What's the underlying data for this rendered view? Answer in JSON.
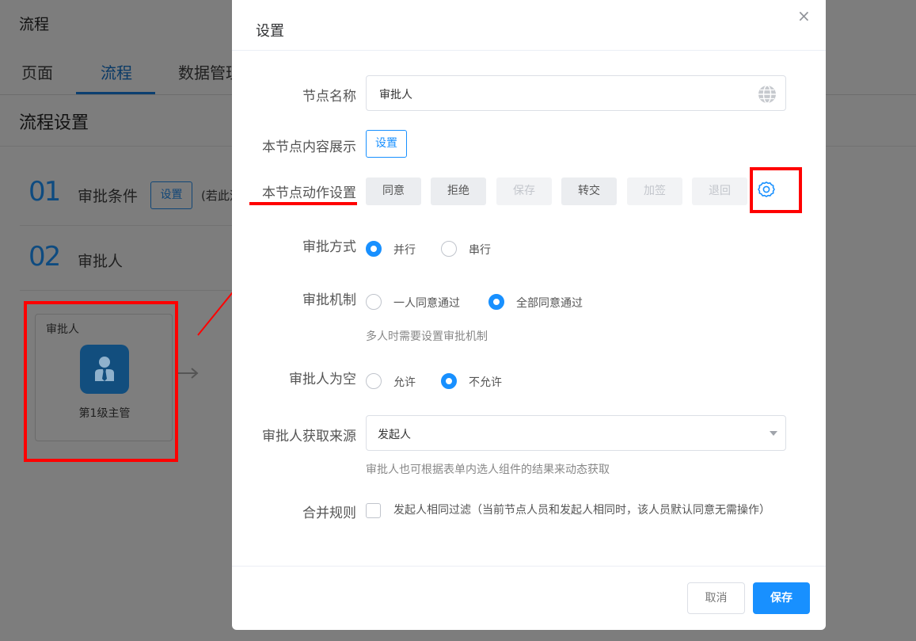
{
  "background": {
    "page_title": "流程",
    "tabs": [
      {
        "label": "页面"
      },
      {
        "label": "流程"
      },
      {
        "label": "数据管理"
      }
    ],
    "section_title": "流程设置",
    "steps": [
      {
        "number": "01",
        "name": "审批条件",
        "button": "设置",
        "note": "(若此流"
      },
      {
        "number": "02",
        "name": "审批人"
      }
    ],
    "node": {
      "label": "审批人",
      "name": "第1级主管",
      "icon": "user-tie-icon"
    }
  },
  "modal": {
    "title": "设置",
    "close_icon": "×",
    "node_name": {
      "label": "节点名称",
      "value": "审批人",
      "icon": "globe-icon"
    },
    "content_display": {
      "label": "本节点内容展示",
      "button": "设置"
    },
    "actions": {
      "label": "本节点动作设置",
      "buttons": [
        {
          "label": "同意",
          "enabled": true
        },
        {
          "label": "拒绝",
          "enabled": true
        },
        {
          "label": "保存",
          "enabled": false
        },
        {
          "label": "转交",
          "enabled": true
        },
        {
          "label": "加签",
          "enabled": false
        },
        {
          "label": "退回",
          "enabled": false
        }
      ],
      "settings_icon": "gear-icon"
    },
    "approval_mode": {
      "label": "审批方式",
      "options": [
        "并行",
        "串行"
      ],
      "selected": "并行"
    },
    "approval_mechanism": {
      "label": "审批机制",
      "options": [
        "一人同意通过",
        "全部同意通过"
      ],
      "selected": "全部同意通过",
      "hint": "多人时需要设置审批机制"
    },
    "empty_approver": {
      "label": "审批人为空",
      "options": [
        "允许",
        "不允许"
      ],
      "selected": "不允许"
    },
    "approver_source": {
      "label": "审批人获取来源",
      "value": "发起人",
      "hint": "审批人也可根据表单内选人组件的结果来动态获取"
    },
    "merge_rule": {
      "label": "合并规则",
      "checkbox_label": "发起人相同过滤（当前节点人员和发起人相同时，该人员默认同意无需操作）",
      "checked": false
    },
    "footer": {
      "cancel": "取消",
      "save": "保存"
    }
  },
  "colors": {
    "primary": "#1890ff",
    "annotation": "#ff0000"
  }
}
